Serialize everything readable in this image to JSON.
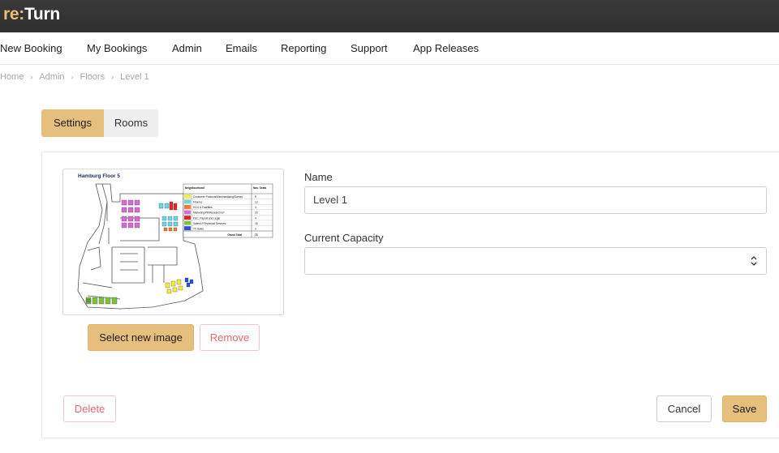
{
  "app": {
    "logo_re": "re:",
    "logo_turn": "Turn"
  },
  "nav": [
    {
      "label": "New Booking"
    },
    {
      "label": "My Bookings"
    },
    {
      "label": "Admin"
    },
    {
      "label": "Emails"
    },
    {
      "label": "Reporting"
    },
    {
      "label": "Support"
    },
    {
      "label": "App Releases"
    }
  ],
  "breadcrumb": [
    "Home",
    "Admin",
    "Floors",
    "Level 1"
  ],
  "tabs": {
    "settings": "Settings",
    "rooms": "Rooms"
  },
  "floor_image": {
    "title": "Hamburg Floor 5",
    "legend_header": "Neighbourhood",
    "legend_count_header": "Nos. Seats",
    "legend": [
      {
        "name": "Consumer Products/Merchandising/Games",
        "count": "9",
        "color": "#f2ee3a"
      },
      {
        "name": "Finance",
        "count": "13",
        "color": "#66d9e8"
      },
      {
        "name": "GCO & Facilities",
        "count": "3",
        "color": "#f07d2a"
      },
      {
        "name": "Marketing/PR/Research/LP",
        "count": "23",
        "color": "#d86ad6"
      },
      {
        "name": "P&C, Payroll and Legal",
        "count": "4",
        "color": "#e8242a"
      },
      {
        "name": "Sales/LP/Technical Services",
        "count": "18",
        "color": "#7cc242"
      },
      {
        "name": "TV Sales",
        "count": "3",
        "color": "#2a4fd8"
      }
    ],
    "grand_total_label": "Grand Total",
    "grand_total": "73"
  },
  "buttons": {
    "select_image": "Select new image",
    "remove": "Remove",
    "delete": "Delete",
    "cancel": "Cancel",
    "save": "Save"
  },
  "form": {
    "name_label": "Name",
    "name_value": "Level 1",
    "capacity_label": "Current Capacity",
    "capacity_value": ""
  },
  "icons": {
    "stepper": "up-down-stepper-icon",
    "breadcrumb_separator": "chevron-right-icon"
  }
}
